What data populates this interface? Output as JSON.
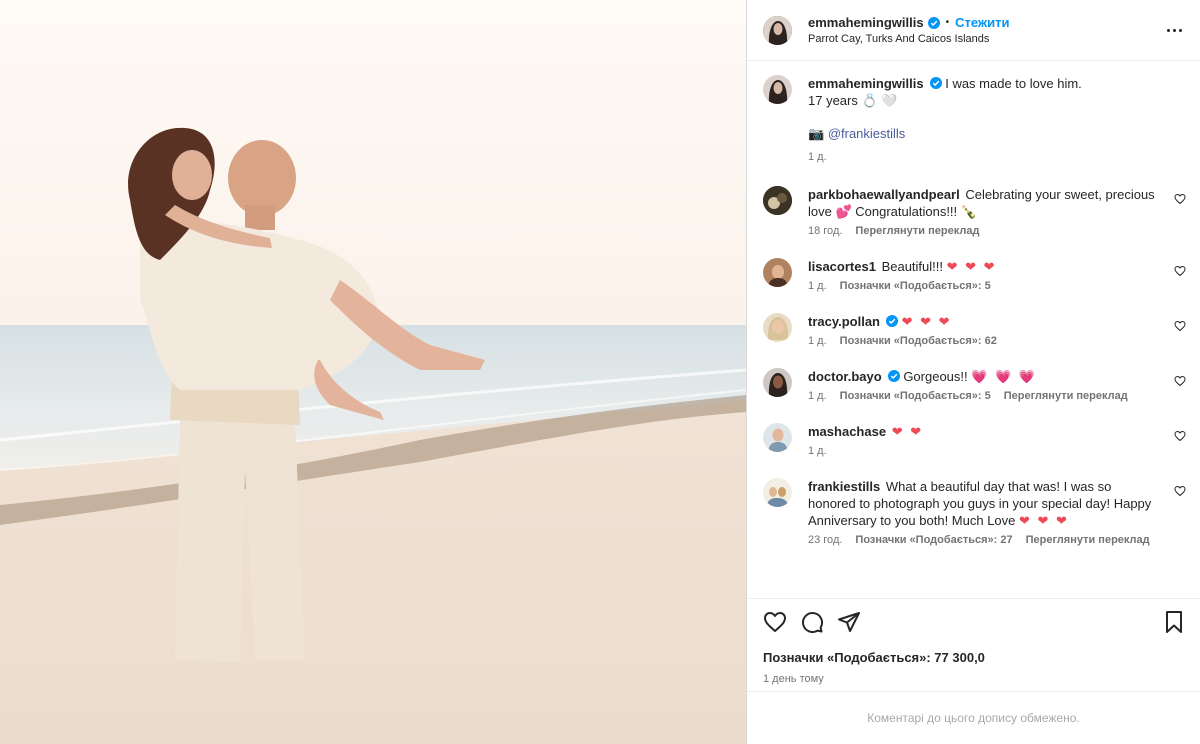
{
  "header": {
    "username": "emmahemingwillis",
    "separator": "•",
    "follow_label": "Стежити",
    "location": "Parrot Cay, Turks And Caicos Islands"
  },
  "caption": {
    "username": "emmahemingwillis",
    "text_line1": "I was made to love him.",
    "text_line2": "17 years 💍 🤍",
    "credit_prefix": "📷",
    "credit_mention": "@frankiestills",
    "time": "1 д."
  },
  "comments": [
    {
      "username": "parkbohaewallyandpearl",
      "text": "Celebrating your sweet, precious love 💕 Congratulations!!! 🍾",
      "time": "18 год.",
      "likes": "",
      "translate": "Переглянути переклад",
      "avatar_color": "#3b3326"
    },
    {
      "username": "lisacortes1",
      "text": "Beautiful!!!",
      "hearts": "❤ ❤ ❤",
      "time": "1 д.",
      "likes": "Позначки «Подобається»: 5",
      "translate": "",
      "avatar_color": "#b08262"
    },
    {
      "username": "tracy.pollan",
      "verified": true,
      "text": "",
      "hearts": "❤ ❤ ❤",
      "time": "1 д.",
      "likes": "Позначки «Подобається»: 62",
      "translate": "",
      "avatar_color": "#d9c39a"
    },
    {
      "username": "doctor.bayo",
      "verified": true,
      "text": "Gorgeous!!",
      "hearts": "💗 💗 💗",
      "time": "1 д.",
      "likes": "Позначки «Подобається»: 5",
      "translate": "Переглянути переклад",
      "avatar_color": "#4a3a33"
    },
    {
      "username": "mashachase",
      "text": "",
      "hearts": "❤ ❤",
      "time": "1 д.",
      "likes": "",
      "translate": "",
      "avatar_color": "#8fa3b5"
    },
    {
      "username": "frankiestills",
      "text": "What a beautiful day that was! I was so honored to photograph you guys in your special day! Happy Anniversary to you both! Much Love",
      "hearts": "❤ ❤ ❤",
      "time": "23 год.",
      "likes": "Позначки «Подобається»: 27",
      "translate": "Переглянути переклад",
      "avatar_color": "#c9b27a"
    }
  ],
  "likes_label": "Позначки «Подобається»: 77 300,0",
  "posted_time": "1 день тому",
  "footer_note": "Коментарі до цього допису обмежено.",
  "colors": {
    "accent": "#0095f6",
    "heart": "#ed4956",
    "mention": "#4a5d9c"
  },
  "icons": [
    "heart-icon",
    "comment-icon",
    "share-icon",
    "bookmark-icon",
    "more-icon",
    "verified-icon"
  ]
}
